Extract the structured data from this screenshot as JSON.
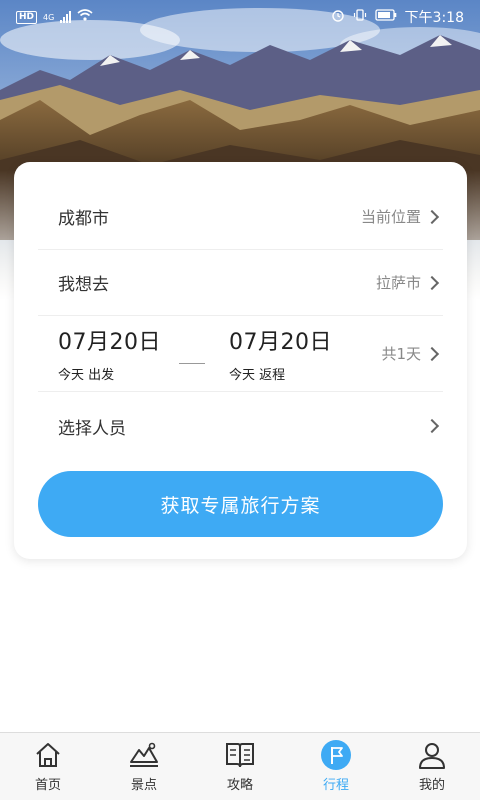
{
  "status_bar": {
    "network": "4G",
    "hd": "HD",
    "time": "下午3:18"
  },
  "trip": {
    "from_city": "成都市",
    "from_hint": "当前位置",
    "to_label": "我想去",
    "to_city": "拉萨市",
    "depart_date": "07月20日",
    "depart_caption": "今天 出发",
    "return_date": "07月20日",
    "return_caption": "今天 返程",
    "duration": "共1天",
    "people_label": "选择人员",
    "cta_label": "获取专属旅行方案"
  },
  "nav": {
    "items": [
      {
        "label": "首页",
        "icon": "home-icon"
      },
      {
        "label": "景点",
        "icon": "scenic-icon"
      },
      {
        "label": "攻略",
        "icon": "guide-book-icon"
      },
      {
        "label": "行程",
        "icon": "flag-icon"
      },
      {
        "label": "我的",
        "icon": "user-icon"
      }
    ],
    "active": "行程"
  },
  "colors": {
    "accent": "#3eaaf4"
  }
}
